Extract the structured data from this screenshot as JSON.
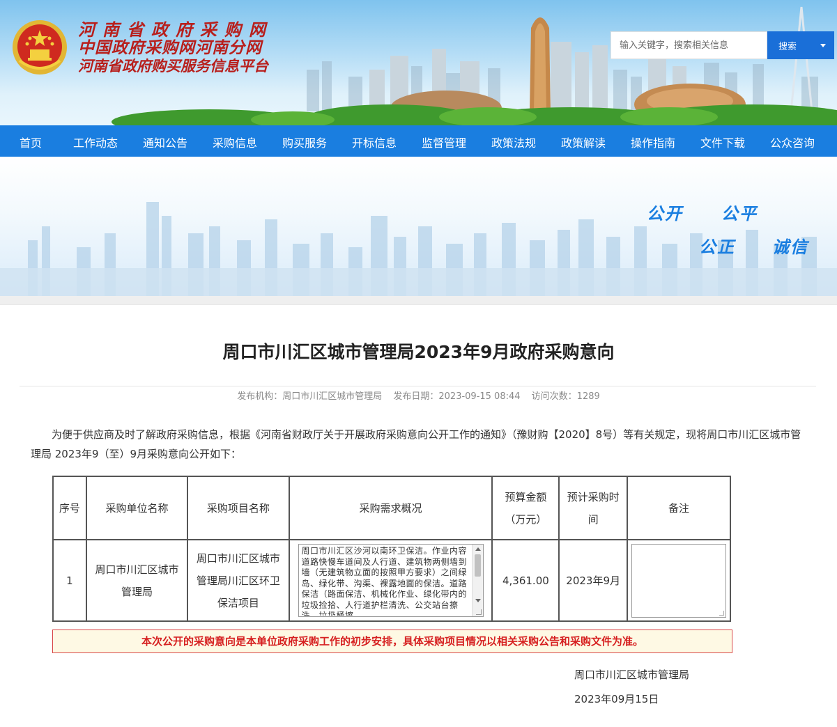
{
  "header": {
    "title_lines": [
      "河南省政府采购网",
      "中国政府采购网河南分网",
      "河南省政府购买服务信息平台"
    ],
    "search_placeholder": "输入关键字，搜索相关信息",
    "search_button": "搜索"
  },
  "nav": {
    "items": [
      "首页",
      "工作动态",
      "通知公告",
      "采购信息",
      "购买服务",
      "开标信息",
      "监督管理",
      "政策法规",
      "政策解读",
      "操作指南",
      "文件下载",
      "公众咨询"
    ]
  },
  "banner": {
    "slogans": [
      "公开",
      "公平",
      "公正",
      "诚信"
    ]
  },
  "article": {
    "title": "周口市川汇区城市管理局2023年9月政府采购意向",
    "meta": {
      "publisher": "发布机构：周口市川汇区城市管理局",
      "date": "发布日期：2023-09-15 08:44",
      "visits": "访问次数：1289"
    },
    "intro": "为便于供应商及时了解政府采购信息，根据《河南省财政厅关于开展政府采购意向公开工作的通知》（豫财购【2020】8号）等有关规定，现将周口市川汇区城市管理局 2023年9（至）9月采购意向公开如下：",
    "table": {
      "headers": [
        "序号",
        "采购单位名称",
        "采购项目名称",
        "采购需求概况",
        "预算金额（万元）",
        "预计采购时间",
        "备注"
      ],
      "rows": [
        {
          "index": "1",
          "unit": "周口市川汇区城市管理局",
          "project": "周口市川汇区城市管理局川汇区环卫保洁项目",
          "summary": "周口市川汇区沙河以南环卫保洁。作业内容道路快慢车道间及人行道、建筑物两侧墙到墙（无建筑物立面的按照甲方要求）之间绿岛、绿化带、沟渠、裸露地面的保洁。道路保洁（路面保洁、机械化作业、绿化带内的垃圾捡拾、人行道护栏清洗、公交站台擦洗、垃圾桶擦",
          "budget": "4,361.00",
          "time": "2023年9月",
          "remark": ""
        }
      ]
    },
    "notice": "本次公开的采购意向是本单位政府采购工作的初步安排，具体采购项目情况以相关采购公告和采购文件为准。",
    "signature_org": "周口市川汇区城市管理局",
    "signature_date": "2023年09月15日"
  }
}
